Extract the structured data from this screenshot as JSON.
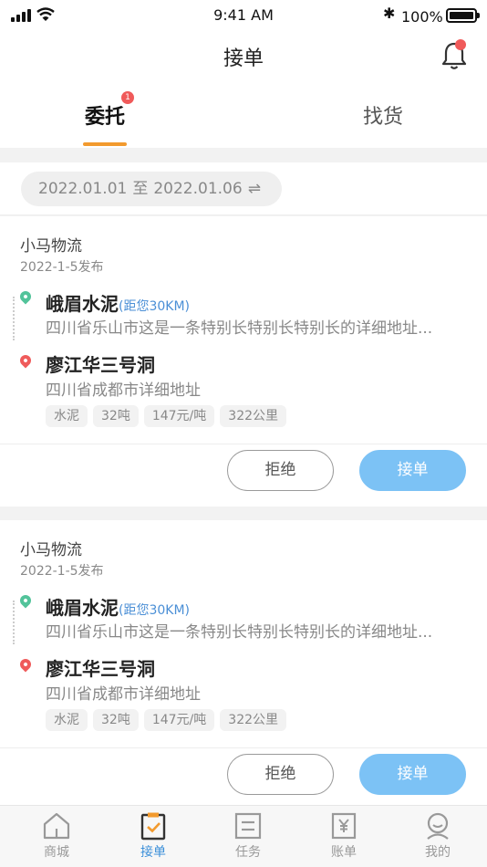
{
  "status_bar": {
    "time": "9:41 AM",
    "battery": "100%"
  },
  "nav": {
    "title": "接单"
  },
  "tabs": {
    "items": [
      "委托",
      "找货"
    ],
    "badge": "1"
  },
  "date_range": {
    "start": "2022.01.01",
    "sep": "至",
    "end": "2022.01.06",
    "swap_icon": "⇌"
  },
  "orders": [
    {
      "company": "小马物流",
      "published": "2022-1-5发布",
      "origin": {
        "name": "峨眉水泥",
        "distance": "(距您30KM)",
        "address": "四川省乐山市这是一条特别长特别长特别长的详细地址..."
      },
      "destination": {
        "name": "廖江华三号洞",
        "address": "四川省成都市详细地址"
      },
      "tags": [
        "水泥",
        "32吨",
        "147元/吨",
        "322公里"
      ],
      "reject_label": "拒绝",
      "accept_label": "接单"
    },
    {
      "company": "小马物流",
      "published": "2022-1-5发布",
      "origin": {
        "name": "峨眉水泥",
        "distance": "(距您30KM)",
        "address": "四川省乐山市这是一条特别长特别长特别长的详细地址..."
      },
      "destination": {
        "name": "廖江华三号洞",
        "address": "四川省成都市详细地址"
      },
      "tags": [
        "水泥",
        "32吨",
        "147元/吨",
        "322公里"
      ],
      "reject_label": "拒绝",
      "accept_label": "接单"
    }
  ],
  "tab_bar": [
    {
      "label": "商城",
      "icon": "home-icon"
    },
    {
      "label": "接单",
      "icon": "clipboard-check-icon",
      "active": true
    },
    {
      "label": "任务",
      "icon": "task-list-icon"
    },
    {
      "label": "账单",
      "icon": "bill-icon"
    },
    {
      "label": "我的",
      "icon": "user-icon"
    }
  ],
  "colors": {
    "accent": "#f29a2e",
    "accept": "#7cc2f5",
    "link": "#4b8fd6",
    "active_tab": "#3b8fd9",
    "badge": "#f05a5a"
  }
}
